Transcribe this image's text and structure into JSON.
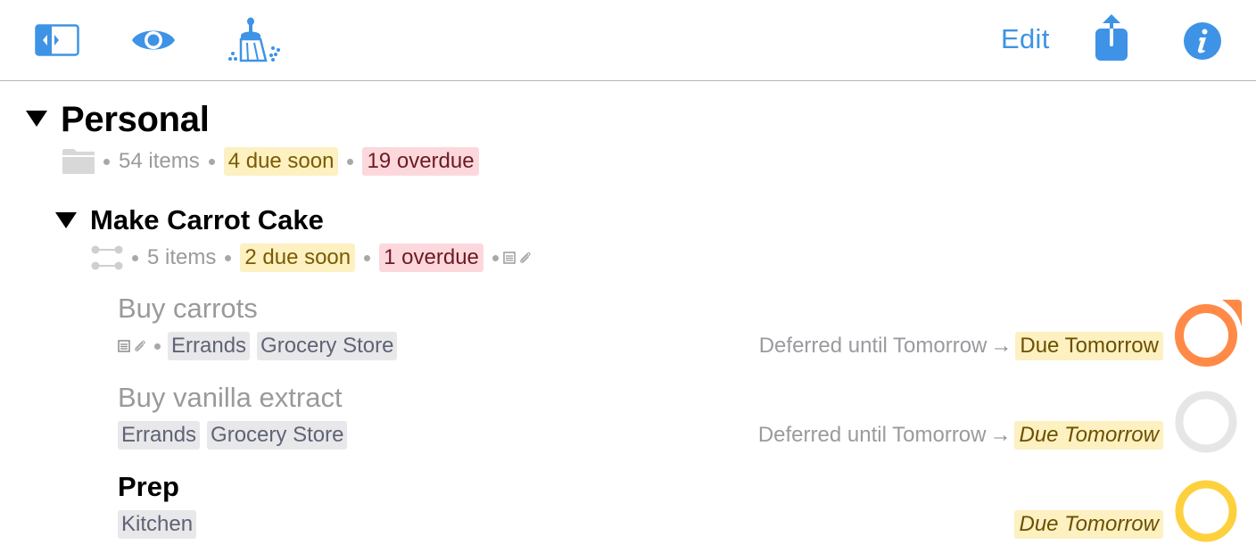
{
  "toolbar": {
    "icons": {
      "sidebar": "sidebar-toggle-icon",
      "view": "eye-icon",
      "clean_up": "broom-icon",
      "share": "share-icon",
      "info": "info-icon"
    },
    "edit_label": "Edit",
    "accent_color": "#3e93e6"
  },
  "folder": {
    "title": "Personal",
    "icon": "folder-icon",
    "items_count": "54 items",
    "due_soon": "4 due soon",
    "overdue": "19 overdue"
  },
  "project": {
    "title": "Make Carrot Cake",
    "icon": "parallel-project-icon",
    "items_count": "5 items",
    "due_soon": "2 due soon",
    "overdue": "1 overdue",
    "has_note": true,
    "has_attachment": true
  },
  "tasks": [
    {
      "title": "Buy carrots",
      "has_note": true,
      "has_attachment": true,
      "tags": [
        "Errands",
        "Grocery Store"
      ],
      "deferred": "Deferred until Tomorrow",
      "arrow": "→",
      "due": "Due Tomorrow",
      "status": "flagged",
      "status_color": "#ff8a47",
      "available": false
    },
    {
      "title": "Buy vanilla extract",
      "tags": [
        "Errands",
        "Grocery Store"
      ],
      "deferred": "Deferred until Tomorrow",
      "arrow": "→",
      "due": "Due Tomorrow",
      "status": "deferred",
      "status_color": "#e6e6e6",
      "available": false
    },
    {
      "title": "Prep",
      "tags": [
        "Kitchen"
      ],
      "due": "Due Tomorrow",
      "status": "due-soon",
      "status_color": "#fdd13e",
      "available": true
    }
  ],
  "colors": {
    "due_soon_bg": "#fdf0c1",
    "due_soon_text": "#7b5b00",
    "overdue_bg": "#fcd8dd",
    "overdue_text": "#6d1a24",
    "tag_bg": "#e8e8ea"
  }
}
